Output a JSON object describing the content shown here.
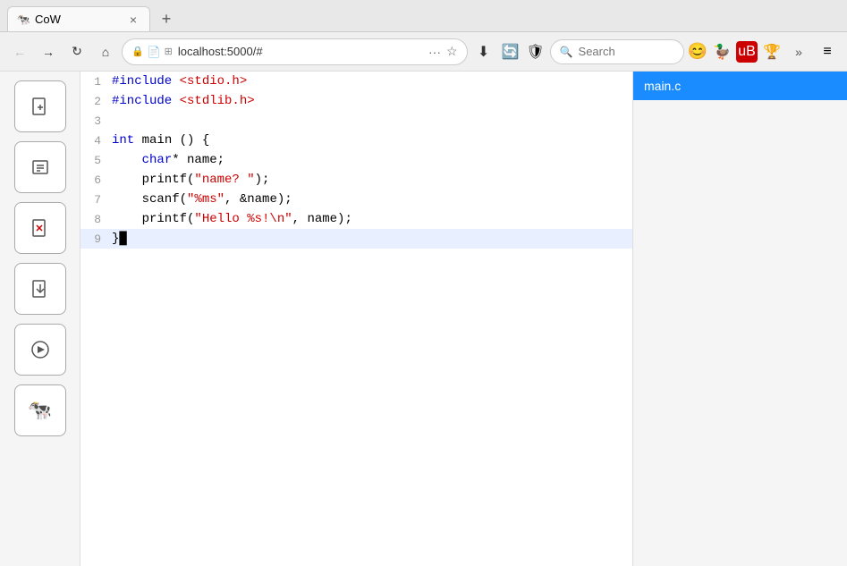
{
  "browser": {
    "tab": {
      "favicon": "🐄",
      "title": "CoW",
      "close_label": "×"
    },
    "new_tab_label": "+",
    "nav": {
      "back_label": "←",
      "forward_label": "→",
      "reload_label": "↻",
      "home_label": "⌂",
      "address": "localhost:5000/#",
      "address_icons": [
        "🔒",
        "ℹ",
        "📄",
        "⊞"
      ],
      "more_label": "···",
      "star_label": "☆",
      "download_label": "⬇",
      "search_placeholder": "Search",
      "emoji_btn": "😊",
      "duck_btn": "🦆",
      "shield_btn": "🛡",
      "cup_btn": "🏆",
      "extensions_label": "»",
      "menu_label": "≡"
    }
  },
  "sidebar": {
    "buttons": [
      {
        "icon": "+",
        "name": "new-file-button",
        "title": "New File"
      },
      {
        "icon": "⋯",
        "name": "open-file-button",
        "title": "Open File"
      },
      {
        "icon": "✕",
        "name": "close-file-button",
        "title": "Close File"
      },
      {
        "icon": "⬇",
        "name": "download-button",
        "title": "Download"
      },
      {
        "icon": "▶",
        "name": "run-button",
        "title": "Run"
      },
      {
        "icon": "🐄",
        "name": "cow-button",
        "title": "CoW"
      }
    ]
  },
  "editor": {
    "lines": [
      {
        "num": 1,
        "content": "#include <stdio.h>",
        "highlighted": false
      },
      {
        "num": 2,
        "content": "#include <stdlib.h>",
        "highlighted": false
      },
      {
        "num": 3,
        "content": "",
        "highlighted": false
      },
      {
        "num": 4,
        "content": "int main () {",
        "highlighted": false
      },
      {
        "num": 5,
        "content": "    char* name;",
        "highlighted": false
      },
      {
        "num": 6,
        "content": "    printf(\"name? \");",
        "highlighted": false
      },
      {
        "num": 7,
        "content": "    scanf(\"%ms\", &name);",
        "highlighted": false
      },
      {
        "num": 8,
        "content": "    printf(\"Hello %s!\\n\", name);",
        "highlighted": false
      },
      {
        "num": 9,
        "content": "}",
        "highlighted": true
      }
    ]
  },
  "right_panel": {
    "file_name": "main.c"
  },
  "colors": {
    "file_tab_bg": "#1a8cff",
    "file_tab_text": "#ffffff",
    "highlight_line_bg": "#e8f0ff"
  }
}
